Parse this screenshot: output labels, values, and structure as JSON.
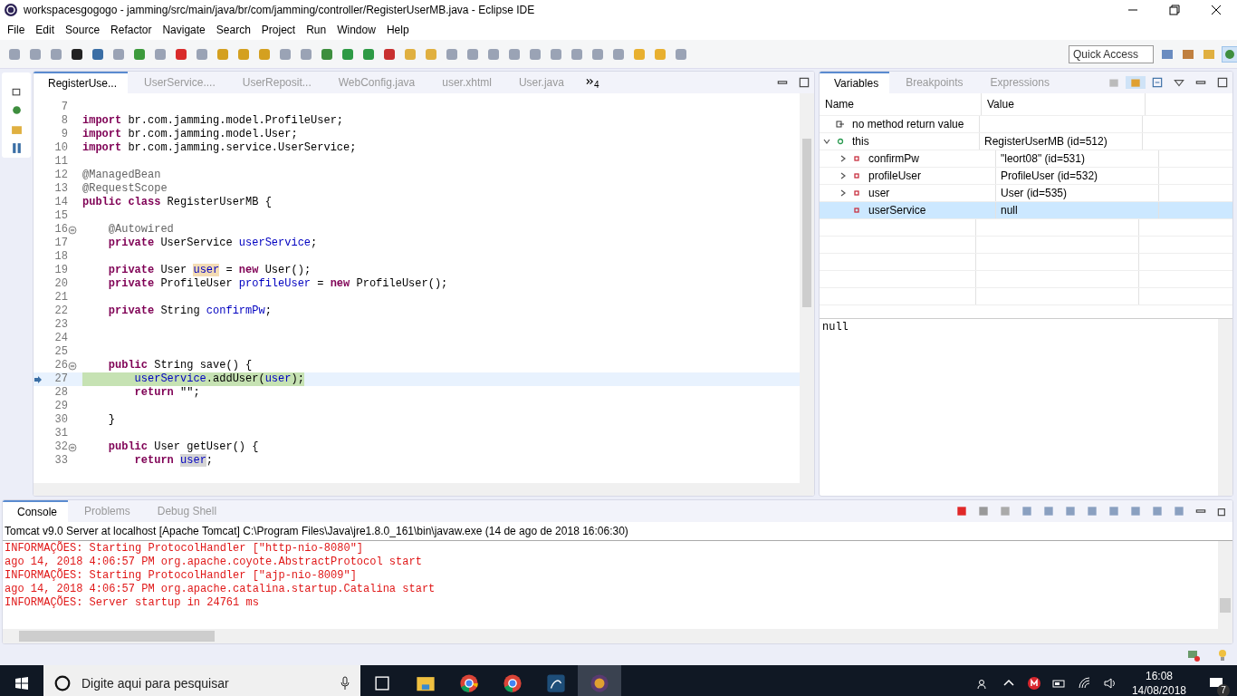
{
  "window": {
    "title": "workspacesgogogo - jamming/src/main/java/br/com/jamming/controller/RegisterUserMB.java - Eclipse IDE"
  },
  "menu": [
    "File",
    "Edit",
    "Source",
    "Refactor",
    "Navigate",
    "Search",
    "Project",
    "Run",
    "Window",
    "Help"
  ],
  "quick_access": {
    "placeholder": "Quick Access"
  },
  "editor": {
    "tabs": [
      {
        "label": "RegisterUse...",
        "selected": true
      },
      {
        "label": "UserService....",
        "selected": false
      },
      {
        "label": "UserReposit...",
        "selected": false
      },
      {
        "label": "WebConfig.java",
        "selected": false
      },
      {
        "label": "user.xhtml",
        "selected": false
      },
      {
        "label": "User.java",
        "selected": false
      }
    ],
    "overflow_count": "4",
    "lines": [
      {
        "number": "7",
        "fold": false,
        "current": false
      },
      {
        "number": "8",
        "fold": false,
        "current": false,
        "segments": [
          {
            "kind": "kw",
            "text": "import"
          },
          {
            "kind": "plain",
            "text": " br.com.jamming.model.ProfileUser;"
          }
        ]
      },
      {
        "number": "9",
        "fold": false,
        "current": false,
        "segments": [
          {
            "kind": "kw",
            "text": "import"
          },
          {
            "kind": "plain",
            "text": " br.com.jamming.model.User;"
          }
        ]
      },
      {
        "number": "10",
        "fold": false,
        "current": false,
        "segments": [
          {
            "kind": "kw",
            "text": "import"
          },
          {
            "kind": "plain",
            "text": " br.com.jamming.service.UserService;"
          }
        ]
      },
      {
        "number": "11",
        "fold": false,
        "current": false
      },
      {
        "number": "12",
        "fold": false,
        "current": false,
        "segments": [
          {
            "kind": "ann",
            "text": "@ManagedBean"
          }
        ]
      },
      {
        "number": "13",
        "fold": false,
        "current": false,
        "segments": [
          {
            "kind": "ann",
            "text": "@RequestScope"
          }
        ]
      },
      {
        "number": "14",
        "fold": false,
        "current": false,
        "segments": [
          {
            "kind": "kw",
            "text": "public class"
          },
          {
            "kind": "plain",
            "text": " RegisterUserMB {"
          }
        ]
      },
      {
        "number": "15",
        "fold": false,
        "current": false
      },
      {
        "number": "16",
        "fold": true,
        "current": false,
        "segments": [
          {
            "kind": "ann",
            "text": "    @Autowired"
          }
        ]
      },
      {
        "number": "17",
        "fold": false,
        "current": false,
        "segments": [
          {
            "kind": "kw",
            "text": "    private"
          },
          {
            "kind": "plain",
            "text": " UserService "
          },
          {
            "kind": "field",
            "text": "userService"
          },
          {
            "kind": "plain",
            "text": ";"
          }
        ]
      },
      {
        "number": "18",
        "fold": false,
        "current": false
      },
      {
        "number": "19",
        "fold": false,
        "current": false,
        "segments": [
          {
            "kind": "kw",
            "text": "    private"
          },
          {
            "kind": "plain",
            "text": " User "
          },
          {
            "kind": "field-write",
            "text": "user"
          },
          {
            "kind": "plain",
            "text": " = "
          },
          {
            "kind": "kw",
            "text": "new"
          },
          {
            "kind": "plain",
            "text": " User();"
          }
        ]
      },
      {
        "number": "20",
        "fold": false,
        "current": false,
        "segments": [
          {
            "kind": "kw",
            "text": "    private"
          },
          {
            "kind": "plain",
            "text": " ProfileUser "
          },
          {
            "kind": "field",
            "text": "profileUser"
          },
          {
            "kind": "plain",
            "text": " = "
          },
          {
            "kind": "kw",
            "text": "new"
          },
          {
            "kind": "plain",
            "text": " ProfileUser();"
          }
        ]
      },
      {
        "number": "21",
        "fold": false,
        "current": false
      },
      {
        "number": "22",
        "fold": false,
        "current": false,
        "segments": [
          {
            "kind": "kw",
            "text": "    private"
          },
          {
            "kind": "plain",
            "text": " String "
          },
          {
            "kind": "field",
            "text": "confirmPw"
          },
          {
            "kind": "plain",
            "text": ";"
          }
        ]
      },
      {
        "number": "23",
        "fold": false,
        "current": false
      },
      {
        "number": "24",
        "fold": false,
        "current": false
      },
      {
        "number": "25",
        "fold": false,
        "current": false
      },
      {
        "number": "26",
        "fold": true,
        "current": false,
        "segments": [
          {
            "kind": "kw",
            "text": "    public"
          },
          {
            "kind": "plain",
            "text": " String save() {"
          }
        ]
      },
      {
        "number": "27",
        "fold": false,
        "current": true,
        "segments": [
          {
            "kind": "field",
            "text": "        userService"
          },
          {
            "kind": "plain",
            "text": ".addUser("
          },
          {
            "kind": "field",
            "text": "user"
          },
          {
            "kind": "plain",
            "text": ");"
          }
        ]
      },
      {
        "number": "28",
        "fold": false,
        "current": false,
        "segments": [
          {
            "kind": "kw",
            "text": "        return"
          },
          {
            "kind": "plain",
            "text": " \"\";"
          }
        ]
      },
      {
        "number": "29",
        "fold": false,
        "current": false
      },
      {
        "number": "30",
        "fold": false,
        "current": false,
        "segments": [
          {
            "kind": "plain",
            "text": "    }"
          }
        ]
      },
      {
        "number": "31",
        "fold": false,
        "current": false
      },
      {
        "number": "32",
        "fold": true,
        "current": false,
        "segments": [
          {
            "kind": "kw",
            "text": "    public"
          },
          {
            "kind": "plain",
            "text": " User getUser() {"
          }
        ]
      },
      {
        "number": "33",
        "fold": false,
        "current": false,
        "segments": [
          {
            "kind": "kw",
            "text": "        return "
          },
          {
            "kind": "field-read",
            "text": "user"
          },
          {
            "kind": "plain",
            "text": ";"
          }
        ]
      }
    ]
  },
  "variables": {
    "tabs": [
      {
        "label": "Variables",
        "selected": true
      },
      {
        "label": "Breakpoints",
        "selected": false
      },
      {
        "label": "Expressions",
        "selected": false
      }
    ],
    "columns": [
      "Name",
      "Value"
    ],
    "rows": [
      {
        "kind": "return",
        "name": "no method return value",
        "selected": false
      },
      {
        "kind": "object",
        "name": "this",
        "value": "RegisterUserMB  (id=512)",
        "selected": false,
        "expanded": true,
        "children": [
          {
            "kind": "field",
            "name": "confirmPw",
            "value": "\"leort08\" (id=531)",
            "selected": false,
            "expanded": false
          },
          {
            "kind": "field",
            "name": "profileUser",
            "value": "ProfileUser  (id=532)",
            "selected": false,
            "expanded": false
          },
          {
            "kind": "field",
            "name": "user",
            "value": "User  (id=535)",
            "selected": false,
            "expanded": false
          },
          {
            "kind": "field",
            "name": "userService",
            "value": "null",
            "selected": true
          }
        ]
      }
    ],
    "detail": "null"
  },
  "console": {
    "tabs": [
      {
        "label": "Console",
        "selected": true
      },
      {
        "label": "Problems",
        "selected": false
      },
      {
        "label": "Debug Shell",
        "selected": false
      }
    ],
    "process": "Tomcat v9.0 Server at localhost [Apache Tomcat] C:\\Program Files\\Java\\jre1.8.0_161\\bin\\javaw.exe (14 de ago de 2018 16:06:30)",
    "lines": [
      "INFORMAÇÕES: Starting ProtocolHandler [\"http-nio-8080\"]",
      "ago 14, 2018 4:06:57 PM org.apache.coyote.AbstractProtocol start",
      "INFORMAÇÕES: Starting ProtocolHandler [\"ajp-nio-8009\"]",
      "ago 14, 2018 4:06:57 PM org.apache.catalina.startup.Catalina start",
      "INFORMAÇÕES: Server startup in 24761 ms"
    ]
  },
  "taskbar": {
    "search": {
      "placeholder": "Digite aqui para pesquisar"
    },
    "time": "16:08",
    "date": "14/08/2018",
    "notifications": "7"
  }
}
